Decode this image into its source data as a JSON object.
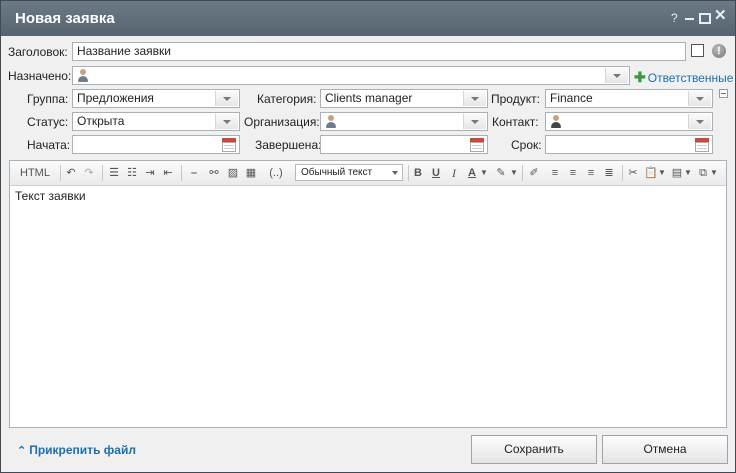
{
  "window": {
    "title": "Новая заявка",
    "help_symbol": "?",
    "close_symbol": "✕"
  },
  "form": {
    "title_label": "Заголовок:",
    "title_value": "Название заявки",
    "assigned_label": "Назначено:",
    "assigned_value": "",
    "responsible_link": "Ответственные",
    "group_label": "Группа:",
    "group_value": "Предложения",
    "category_label": "Категория:",
    "category_value": "Clients manager",
    "product_label": "Продукт:",
    "product_value": "Finance",
    "status_label": "Статус:",
    "status_value": "Открыта",
    "organization_label": "Организация:",
    "organization_value": "",
    "contact_label": "Контакт:",
    "contact_value": "",
    "started_label": "Начата:",
    "started_value": "",
    "finished_label": "Завершена:",
    "finished_value": "",
    "due_label": "Срок:",
    "due_value": ""
  },
  "editor": {
    "html_label": "HTML",
    "format_value": "Обычный текст",
    "bold": "B",
    "underline": "U",
    "italic": "I",
    "font_color": "A",
    "insert_label": "(..)",
    "content": "Текст заявки"
  },
  "footer": {
    "attach_label": "Прикрепить файл",
    "save_label": "Сохранить",
    "cancel_label": "Отмена"
  }
}
